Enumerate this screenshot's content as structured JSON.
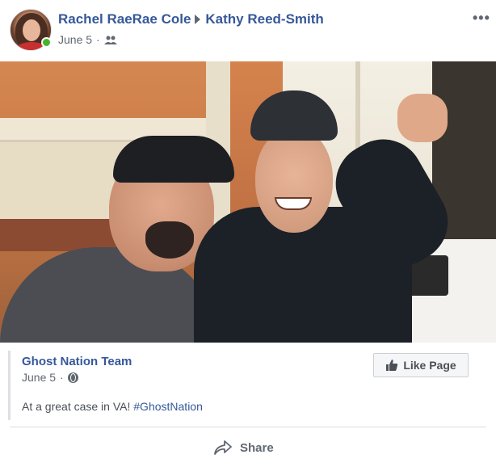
{
  "post": {
    "author": "Rachel RaeRae Cole",
    "target": "Kathy Reed-Smith",
    "date": "June 5",
    "separator": "·",
    "audience_icon": "friends-icon",
    "more_label": "•••"
  },
  "shared_page": {
    "name": "Ghost Nation Team",
    "date": "June 5",
    "separator": "·",
    "visibility_icon": "globe-icon",
    "text": "At a great case in VA!",
    "hashtag": "#GhostNation",
    "like_page_label": "Like Page"
  },
  "actions": {
    "share_label": "Share"
  },
  "colors": {
    "link_blue": "#365899",
    "meta_gray": "#616770",
    "online_green": "#42b72a"
  }
}
